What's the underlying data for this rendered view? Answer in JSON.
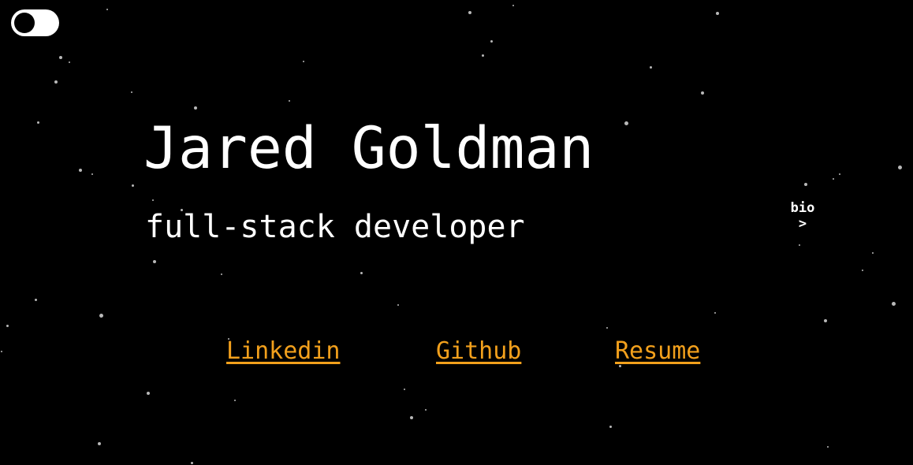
{
  "theme_toggle": {
    "state": "dark"
  },
  "hero": {
    "name": "Jared Goldman",
    "subtitle": "full-stack developer"
  },
  "bio_link": {
    "label": "bio",
    "arrow": ">"
  },
  "links": [
    {
      "label": "Linkedin"
    },
    {
      "label": "Github"
    },
    {
      "label": "Resume"
    }
  ],
  "colors": {
    "background": "#000000",
    "text": "#ffffff",
    "link": "#f2a01c",
    "star": "#b8b8b8"
  }
}
